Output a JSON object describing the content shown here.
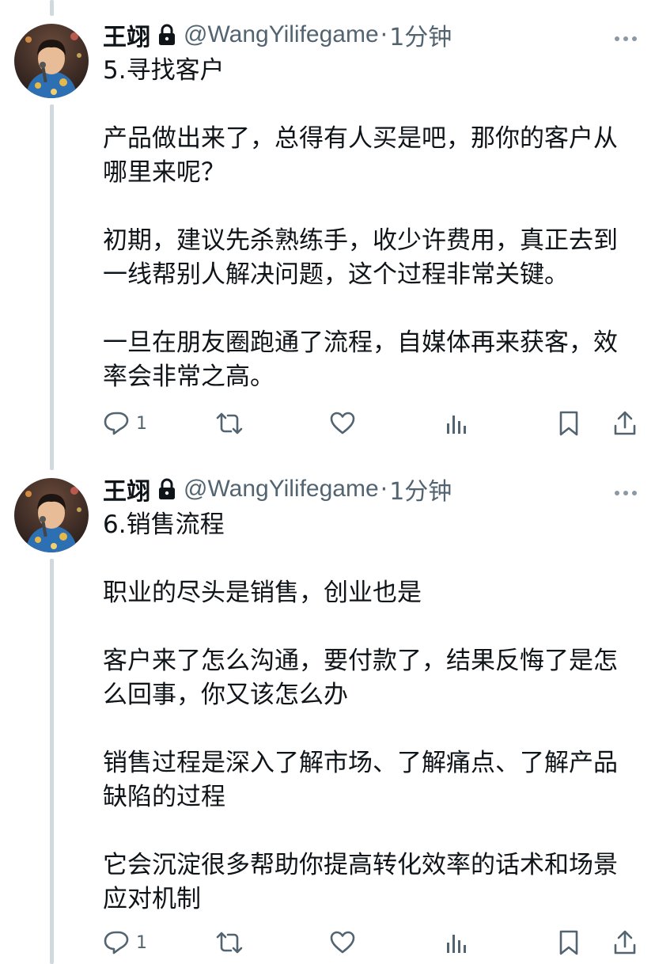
{
  "tweets": [
    {
      "author": {
        "name": "王翊",
        "handle": "@WangYilifegame",
        "time": "1分钟",
        "separator": "·",
        "lock_icon": "lock-icon",
        "avatar": "user-avatar"
      },
      "body": "5.寻找客户\n\n产品做出来了，总得有人买是吧，那你的客户从哪里来呢？\n\n初期，建议先杀熟练手，收少许费用，真正去到一线帮别人解决问题，这个过程非常关键。\n\n一旦在朋友圈跑通了流程，自媒体再来获客，效率会非常之高。",
      "actions": {
        "reply_count": "1",
        "icons": [
          "reply-icon",
          "retweet-icon",
          "like-icon",
          "views-icon",
          "bookmark-icon",
          "share-icon"
        ]
      }
    },
    {
      "author": {
        "name": "王翊",
        "handle": "@WangYilifegame",
        "time": "1分钟",
        "separator": "·",
        "lock_icon": "lock-icon",
        "avatar": "user-avatar"
      },
      "body": "6.销售流程\n\n职业的尽头是销售，创业也是\n\n客户来了怎么沟通，要付款了，结果反悔了是怎么回事，你又该怎么办\n\n销售过程是深入了解市场、了解痛点、了解产品缺陷的过程\n\n它会沉淀很多帮助你提高转化效率的话术和场景应对机制",
      "actions": {
        "reply_count": "1",
        "icons": [
          "reply-icon",
          "retweet-icon",
          "like-icon",
          "views-icon",
          "bookmark-icon",
          "share-icon"
        ]
      }
    }
  ],
  "colors": {
    "text": "#0f1419",
    "muted": "#536471",
    "thread_line": "#cfd9de",
    "background": "#ffffff"
  }
}
